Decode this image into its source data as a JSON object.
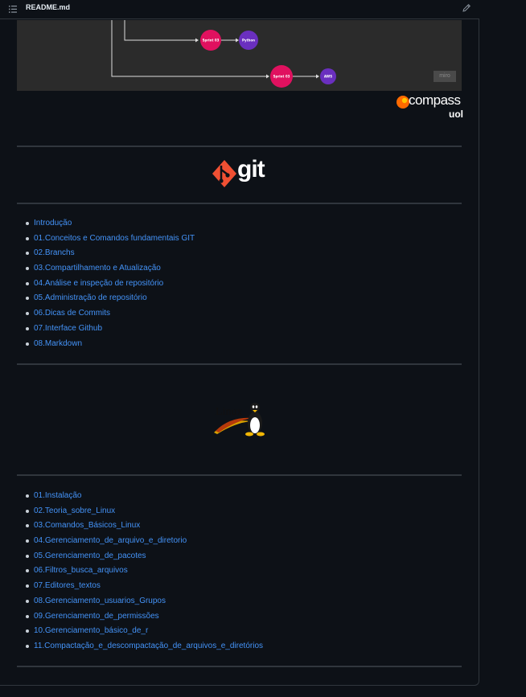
{
  "header": {
    "file_name": "README.md",
    "list_icon": "list-icon",
    "edit_icon": "pencil-icon"
  },
  "miro_board": {
    "watermark": "miro",
    "nodes": [
      {
        "label": "Sprint 03",
        "color": "#e0115f"
      },
      {
        "label": "Python",
        "color": "#6a2fbf"
      },
      {
        "label": "Sprint 03",
        "color": "#e0115f"
      },
      {
        "label": "AWS",
        "color": "#6a2fbf"
      }
    ]
  },
  "compass_logo": {
    "word": "compass",
    "sub": "uol",
    "accent": "#ff6a00"
  },
  "git_logo": {
    "word": "git",
    "accent": "#f05033"
  },
  "git_links": [
    "Introdução",
    "01.Conceitos e Comandos fundamentais GIT",
    "02.Branchs",
    "03.Compartilhamento e Atualização",
    "04.Análise e inspeção de repositório",
    "05.Administração de repositório",
    "06.Dicas de Commits",
    "07.Interface Github",
    "08.Markdown"
  ],
  "linux_logo": {
    "word": "Linux"
  },
  "linux_links": [
    "01.Instalação",
    "02.Teoria_sobre_Linux",
    "03.Comandos_Básicos_Linux",
    "04.Gerenciamento_de_arquivo_e_diretorio",
    "05.Gerenciamento_de_pacotes",
    "06.Filtros_busca_arquivos",
    "07.Editores_textos",
    "08.Gerenciamento_usuarios_Grupos",
    "09.Gerenciamento_de_permissões",
    "10.Gerenciamento_básico_de_r",
    "11.Compactação_e_descompactação_de_arquivos_e_diretórios"
  ],
  "colors": {
    "background": "#0d1117",
    "link": "#4493f8",
    "border": "#30363d"
  }
}
